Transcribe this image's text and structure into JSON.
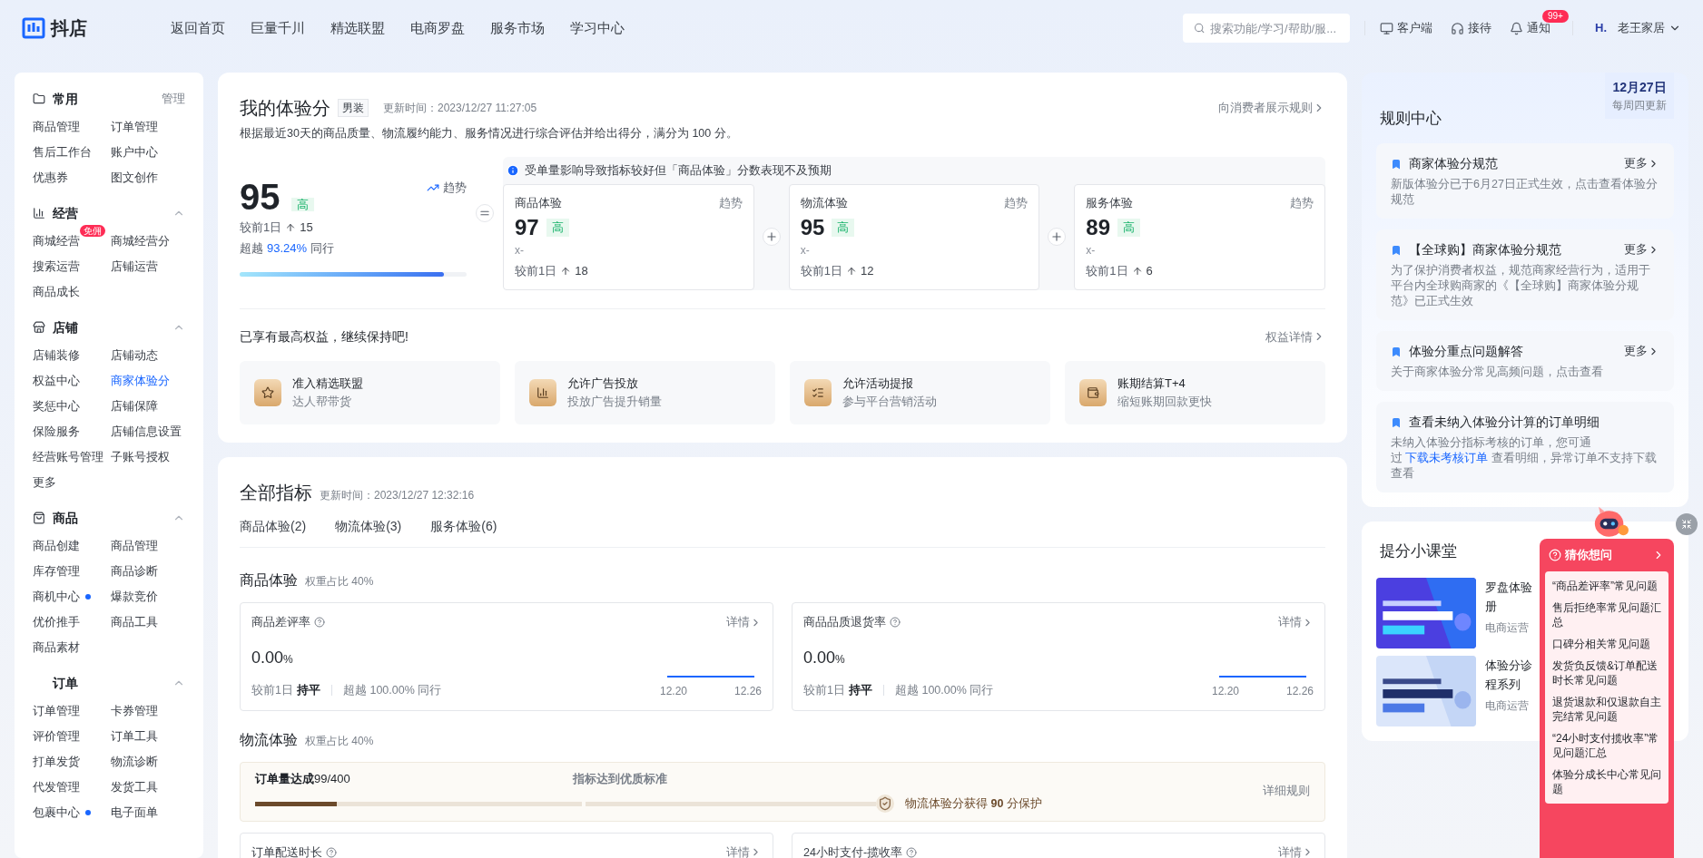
{
  "header": {
    "logo": "抖店",
    "nav": [
      "返回首页",
      "巨量千川",
      "精选联盟",
      "电商罗盘",
      "服务市场",
      "学习中心"
    ],
    "search": {
      "placeholder": "搜索功能/学习/帮助/服..."
    },
    "tools": [
      {
        "kind": "client",
        "label": "客户端"
      },
      {
        "kind": "service",
        "label": "接待"
      },
      {
        "kind": "bell",
        "label": "通知",
        "badge": "99+"
      }
    ],
    "account": {
      "avatar": "H.",
      "name": "老王家居"
    }
  },
  "sidebar": {
    "sections": [
      {
        "kind": "folder",
        "title": "常用",
        "action": "管理",
        "items": [
          {
            "label": "商品管理",
            "selected": false
          },
          {
            "label": "订单管理",
            "selected": false
          },
          {
            "label": "售后工作台",
            "selected": false
          },
          {
            "label": "账户中心",
            "selected": false
          },
          {
            "label": "优惠券",
            "selected": false
          },
          {
            "label": "图文创作",
            "selected": false
          }
        ]
      },
      {
        "kind": "chart",
        "title": "经营",
        "expanded": true,
        "items": [
          {
            "label": "商城经营",
            "badge": "免佣",
            "selected": false
          },
          {
            "label": "商城经营分",
            "selected": false
          },
          {
            "label": "搜索运营",
            "selected": false
          },
          {
            "label": "店铺运营",
            "selected": false
          },
          {
            "label": "商品成长",
            "selected": false
          }
        ]
      },
      {
        "kind": "shop",
        "title": "店铺",
        "expanded": true,
        "items": [
          {
            "label": "店铺装修",
            "selected": false
          },
          {
            "label": "店铺动态",
            "selected": false
          },
          {
            "label": "权益中心",
            "selected": false
          },
          {
            "label": "商家体验分",
            "selected": true
          },
          {
            "label": "奖惩中心",
            "selected": false
          },
          {
            "label": "店铺保障",
            "selected": false
          },
          {
            "label": "保险服务",
            "selected": false
          },
          {
            "label": "店铺信息设置",
            "selected": false
          },
          {
            "label": "经营账号管理",
            "selected": false
          },
          {
            "label": "子账号授权",
            "selected": false
          },
          {
            "label": "更多",
            "selected": false
          }
        ]
      },
      {
        "kind": "bag",
        "title": "商品",
        "expanded": true,
        "items": [
          {
            "label": "商品创建",
            "selected": false
          },
          {
            "label": "商品管理",
            "selected": false
          },
          {
            "label": "库存管理",
            "selected": false
          },
          {
            "label": "商品诊断",
            "selected": false
          },
          {
            "label": "商机中心",
            "dot": true,
            "selected": false
          },
          {
            "label": "爆款竞价",
            "selected": false
          },
          {
            "label": "优价推手",
            "selected": false
          },
          {
            "label": "商品工具",
            "selected": false
          },
          {
            "label": "商品素材",
            "selected": false
          }
        ]
      },
      {
        "kind": "none",
        "title": "订单",
        "expanded": true,
        "items": [
          {
            "label": "订单管理",
            "selected": false
          },
          {
            "label": "卡券管理",
            "selected": false
          },
          {
            "label": "评价管理",
            "selected": false
          },
          {
            "label": "订单工具",
            "selected": false
          },
          {
            "label": "打单发货",
            "selected": false
          },
          {
            "label": "物流诊断",
            "selected": false
          },
          {
            "label": "代发管理",
            "selected": false
          },
          {
            "label": "发货工具",
            "selected": false
          },
          {
            "label": "包裹中心",
            "dot": true,
            "selected": false
          },
          {
            "label": "电子面单",
            "selected": false
          }
        ]
      }
    ]
  },
  "score_card": {
    "title": "我的体验分",
    "tag": "男装",
    "updated": "更新时间：2023/12/27 11:27:05",
    "description": "根据最近30天的商品质量、物流履约能力、服务情况进行综合评估并给出得分，满分为 100 分。",
    "rule_link": "向消费者展示规则",
    "total": {
      "score": "95",
      "grade": "高",
      "trend": "趋势",
      "compare_label": "较前1日",
      "change": "15",
      "beat_label": "超越",
      "beat": "93.24%",
      "peer_label": "同行",
      "level": 0.9
    },
    "notice": "受单量影响导致指标较好但「商品体验」分数表现不及预期",
    "parts": [
      {
        "name": "商品体验",
        "trend": "趋势",
        "score": "97",
        "grade": "高",
        "sub": "x-",
        "compare_label": "较前1日",
        "change": "18"
      },
      {
        "name": "物流体验",
        "trend": "趋势",
        "score": "95",
        "grade": "高",
        "sub": "x-",
        "compare_label": "较前1日",
        "change": "12"
      },
      {
        "name": "服务体验",
        "trend": "趋势",
        "score": "89",
        "grade": "高",
        "sub": "x-",
        "compare_label": "较前1日",
        "change": "6"
      }
    ],
    "benefits_title": "已享有最高权益，继续保持吧!",
    "benefits_link": "权益详情",
    "benefits": [
      {
        "kind": "star",
        "title": "准入精选联盟",
        "subtitle": "达人帮带货"
      },
      {
        "kind": "chart",
        "title": "允许广告投放",
        "subtitle": "投放广告提升销量"
      },
      {
        "kind": "list",
        "title": "允许活动提报",
        "subtitle": "参与平台营销活动"
      },
      {
        "kind": "money",
        "title": "账期结算T+4",
        "subtitle": "缩短账期回款更快"
      }
    ]
  },
  "metrics": {
    "title": "全部指标",
    "updated": "更新时间：2023/12/27 12:32:16",
    "tabs": [
      "商品体验(2)",
      "物流体验(3)",
      "服务体验(6)"
    ],
    "product": {
      "title": "商品体验",
      "weight": "权重占比 40%",
      "cards": [
        {
          "name": "商品差评率",
          "detail": "详情",
          "value": "0.00",
          "unit": "%",
          "compare_label": "较前1日",
          "compare": "持平",
          "beat": "超越 100.00% 同行",
          "x_start": "12.20",
          "x_end": "12.26"
        },
        {
          "name": "商品品质退货率",
          "detail": "详情",
          "value": "0.00",
          "unit": "%",
          "compare_label": "较前1日",
          "compare": "持平",
          "beat": "超越 100.00% 同行",
          "x_start": "12.20",
          "x_end": "12.26"
        }
      ]
    },
    "logistics": {
      "title": "物流体验",
      "weight": "权重占比 40%",
      "banner": {
        "progress": "**订单量达成**99/400",
        "status": "指标达到优质标准",
        "level": 0.25,
        "protect": "物流体验分获得 **90** 分保护",
        "link": "详细规则"
      },
      "cards": [
        {
          "name": "订单配送时长",
          "detail": "详情"
        },
        {
          "name": "24小时支付-揽收率",
          "detail": "详情"
        }
      ]
    }
  },
  "rules": {
    "title": "规则中心",
    "date": "12月27日",
    "update_note": "每周四更新",
    "items": [
      {
        "title": "商家体验分规范",
        "more": "更多",
        "desc": "新版体验分已于6月27日正式生效，点击查看体验分规范"
      },
      {
        "title": "【全球购】商家体验分规范",
        "more": "更多",
        "desc": "为了保护消费者权益，规范商家经营行为，适用于平台内全球购商家的《【全球购】商家体验分规范》已正式生效"
      },
      {
        "title": "体验分重点问题解答",
        "more": "更多",
        "desc": "关于商家体验分常见高频问题，点击查看"
      },
      {
        "title": "查看未纳入体验分计算的订单明细",
        "desc": "未纳入体验分指标考核的订单，您可通过",
        "link": "下载未考核订单",
        "desc_after": "查看明细，异常订单不支持下载查看"
      }
    ]
  },
  "lessons": {
    "title": "提分小课堂",
    "items": [
      {
        "title": [
          "罗盘体验",
          "册"
        ],
        "source": "电商运营"
      },
      {
        "title": [
          "体验分诊",
          "程系列"
        ],
        "source": "电商运营"
      }
    ]
  },
  "faq_popup": {
    "title": "猜你想问",
    "items": [
      "“商品差评率”常见问题",
      "售后拒绝率常见问题汇总",
      "口碑分相关常见问题",
      "发货负反馈&订单配送时长常见问题",
      "退货退款和仅退款自主完结常见问题",
      "“24小时支付揽收率”常见问题汇总",
      "体验分成长中心常见问题"
    ]
  }
}
